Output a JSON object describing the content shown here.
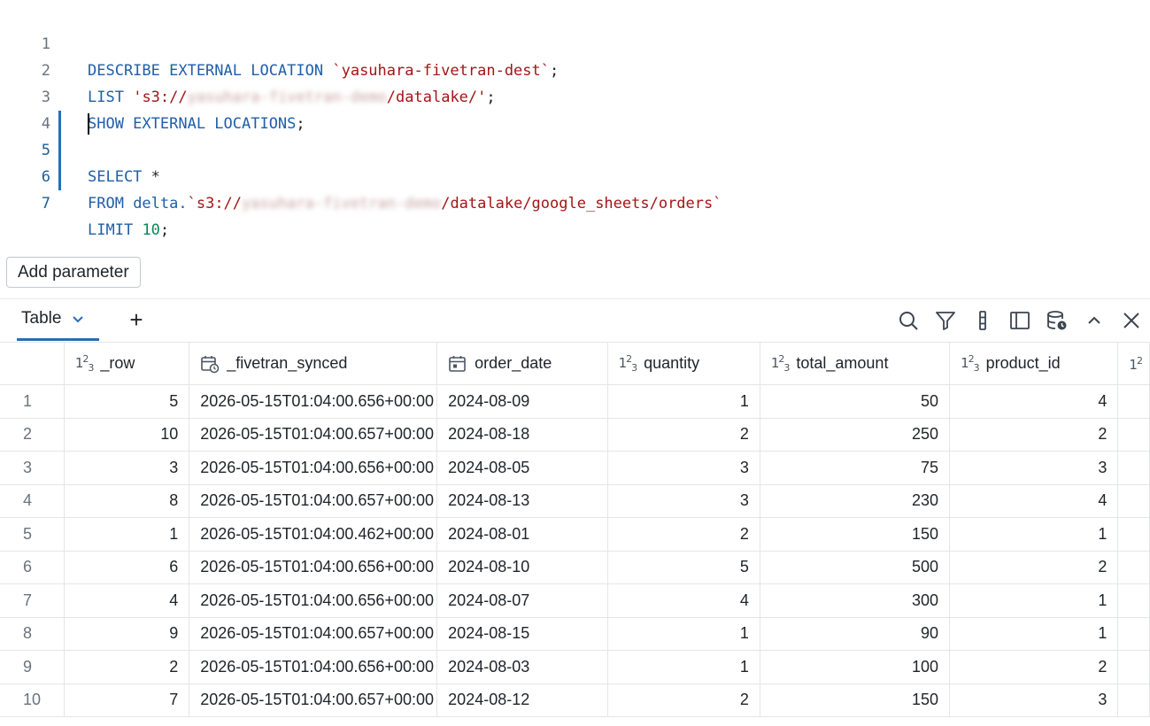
{
  "editor": {
    "line_numbers": [
      "1",
      "2",
      "3",
      "4",
      "5",
      "6",
      "7"
    ],
    "l1_kw": "DESCRIBE EXTERNAL LOCATION",
    "l1_str": "`yasuhara-fivetran-dest`",
    "l1_end": ";",
    "l2_kw": "LIST",
    "l2_str_a": "'s3://",
    "l2_blur": "yasuhara-fivetran-demo",
    "l2_str_b": "/datalake/'",
    "l2_end": ";",
    "l3_kw": "SHOW EXTERNAL LOCATIONS",
    "l3_end": ";",
    "l5_kw": "SELECT",
    "l5_rest": " *",
    "l6_kw": "FROM",
    "l6_plain": " delta.",
    "l6_str_a": "`s3://",
    "l6_blur": "yasuhara-fivetran-demo",
    "l6_str_b": "/datalake/google_sheets/orders`",
    "l7_kw": "LIMIT",
    "l7_num": "10",
    "l7_end": ";"
  },
  "add_parameter_label": "Add parameter",
  "results_tab": {
    "label": "Table",
    "add": "+"
  },
  "toolbar_icons": [
    "search-icon",
    "filter-icon",
    "column-settings-icon",
    "sidebar-panel-icon",
    "data-refresh-icon",
    "collapse-icon",
    "close-icon"
  ],
  "table": {
    "columns": [
      {
        "name": "_row",
        "type": "number"
      },
      {
        "name": "_fivetran_synced",
        "type": "timestamp"
      },
      {
        "name": "order_date",
        "type": "date"
      },
      {
        "name": "quantity",
        "type": "number"
      },
      {
        "name": "total_amount",
        "type": "number"
      },
      {
        "name": "product_id",
        "type": "number"
      }
    ],
    "rows": [
      [
        "1",
        "5",
        "2026-05-15T01:04:00.656+00:00",
        "2024-08-09",
        "1",
        "50",
        "4"
      ],
      [
        "2",
        "10",
        "2026-05-15T01:04:00.657+00:00",
        "2024-08-18",
        "2",
        "250",
        "2"
      ],
      [
        "3",
        "3",
        "2026-05-15T01:04:00.656+00:00",
        "2024-08-05",
        "3",
        "75",
        "3"
      ],
      [
        "4",
        "8",
        "2026-05-15T01:04:00.657+00:00",
        "2024-08-13",
        "3",
        "230",
        "4"
      ],
      [
        "5",
        "1",
        "2026-05-15T01:04:00.462+00:00",
        "2024-08-01",
        "2",
        "150",
        "1"
      ],
      [
        "6",
        "6",
        "2026-05-15T01:04:00.656+00:00",
        "2024-08-10",
        "5",
        "500",
        "2"
      ],
      [
        "7",
        "4",
        "2026-05-15T01:04:00.656+00:00",
        "2024-08-07",
        "4",
        "300",
        "1"
      ],
      [
        "8",
        "9",
        "2026-05-15T01:04:00.657+00:00",
        "2024-08-15",
        "1",
        "90",
        "1"
      ],
      [
        "9",
        "2",
        "2026-05-15T01:04:00.656+00:00",
        "2024-08-03",
        "1",
        "100",
        "2"
      ],
      [
        "10",
        "7",
        "2026-05-15T01:04:00.657+00:00",
        "2024-08-12",
        "2",
        "150",
        "3"
      ]
    ]
  }
}
